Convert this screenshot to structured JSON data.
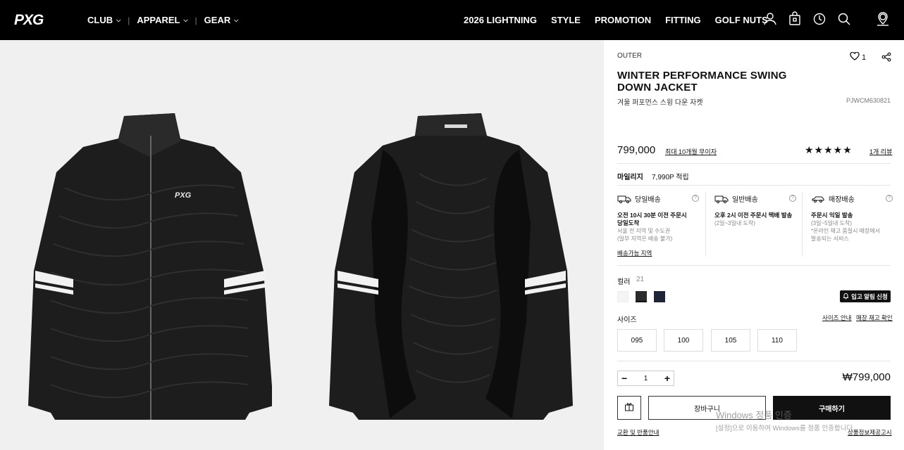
{
  "header": {
    "logo_alt": "PXG",
    "nav_left": [
      {
        "label": "CLUB"
      },
      {
        "label": "APPAREL"
      },
      {
        "label": "GEAR"
      }
    ],
    "nav_right": [
      "2026 LIGHTNING",
      "STYLE",
      "PROMOTION",
      "FITTING",
      "GOLF NUTS"
    ],
    "icons": [
      "user-icon",
      "bag-icon",
      "history-icon",
      "search-icon",
      "store-locator-icon"
    ]
  },
  "gallery": {
    "images": [
      "jacket-front",
      "jacket-back"
    ]
  },
  "product": {
    "category": "OUTER",
    "like_count": "1",
    "title": "WINTER PERFORMANCE SWING DOWN JACKET",
    "subtitle": "겨울 퍼포먼스 스윙 다운 자켓",
    "code": "PJWCM630821",
    "price": "799,000",
    "installment": "최대 10개월 무이자",
    "rating_stars": "★★★★★",
    "review_count": "1개 리뷰",
    "mileage_label": "마일리지",
    "mileage_value": "7,990P 적립",
    "shipping": [
      {
        "title": "당일배송",
        "bold": "오전 10시 30분 이전 주문시\n당일도착",
        "note": "서울 전 지역 및 수도권\n(일부 지역은 배송 불가)"
      },
      {
        "title": "일반배송",
        "bold": "오후 2시 이전 주문시 택배 발송",
        "note": "(2일~3일내 도착)"
      },
      {
        "title": "매장배송",
        "bold": "주문시 익일 발송",
        "note": "(3일~5일내 도착)\n*온라인 재고 품절시 매장에서\n발송되는 서비스"
      }
    ],
    "shipping_area_link": "배송가능 지역",
    "color_label": "컬러",
    "color_count": "21",
    "colors": [
      "#f4f4f4",
      "#2b2b2b",
      "#1f2536"
    ],
    "restock_label": "입고 알림 신청",
    "size_label": "사이즈",
    "size_guide": "사이즈 안내",
    "store_stock": "매장 재고 확인",
    "sizes": [
      "095",
      "100",
      "105",
      "110"
    ],
    "quantity": "1",
    "total_price": "₩799,000",
    "cart_label": "장바구니",
    "buy_label": "구매하기",
    "exchange_link": "교환 및 반품안내",
    "notice_link": "상품정보제공고시"
  },
  "watermark": {
    "line1": "Windows 정품 인증",
    "line2": "[설정]으로 이동하여 Windows를 정품 인증합니다."
  }
}
